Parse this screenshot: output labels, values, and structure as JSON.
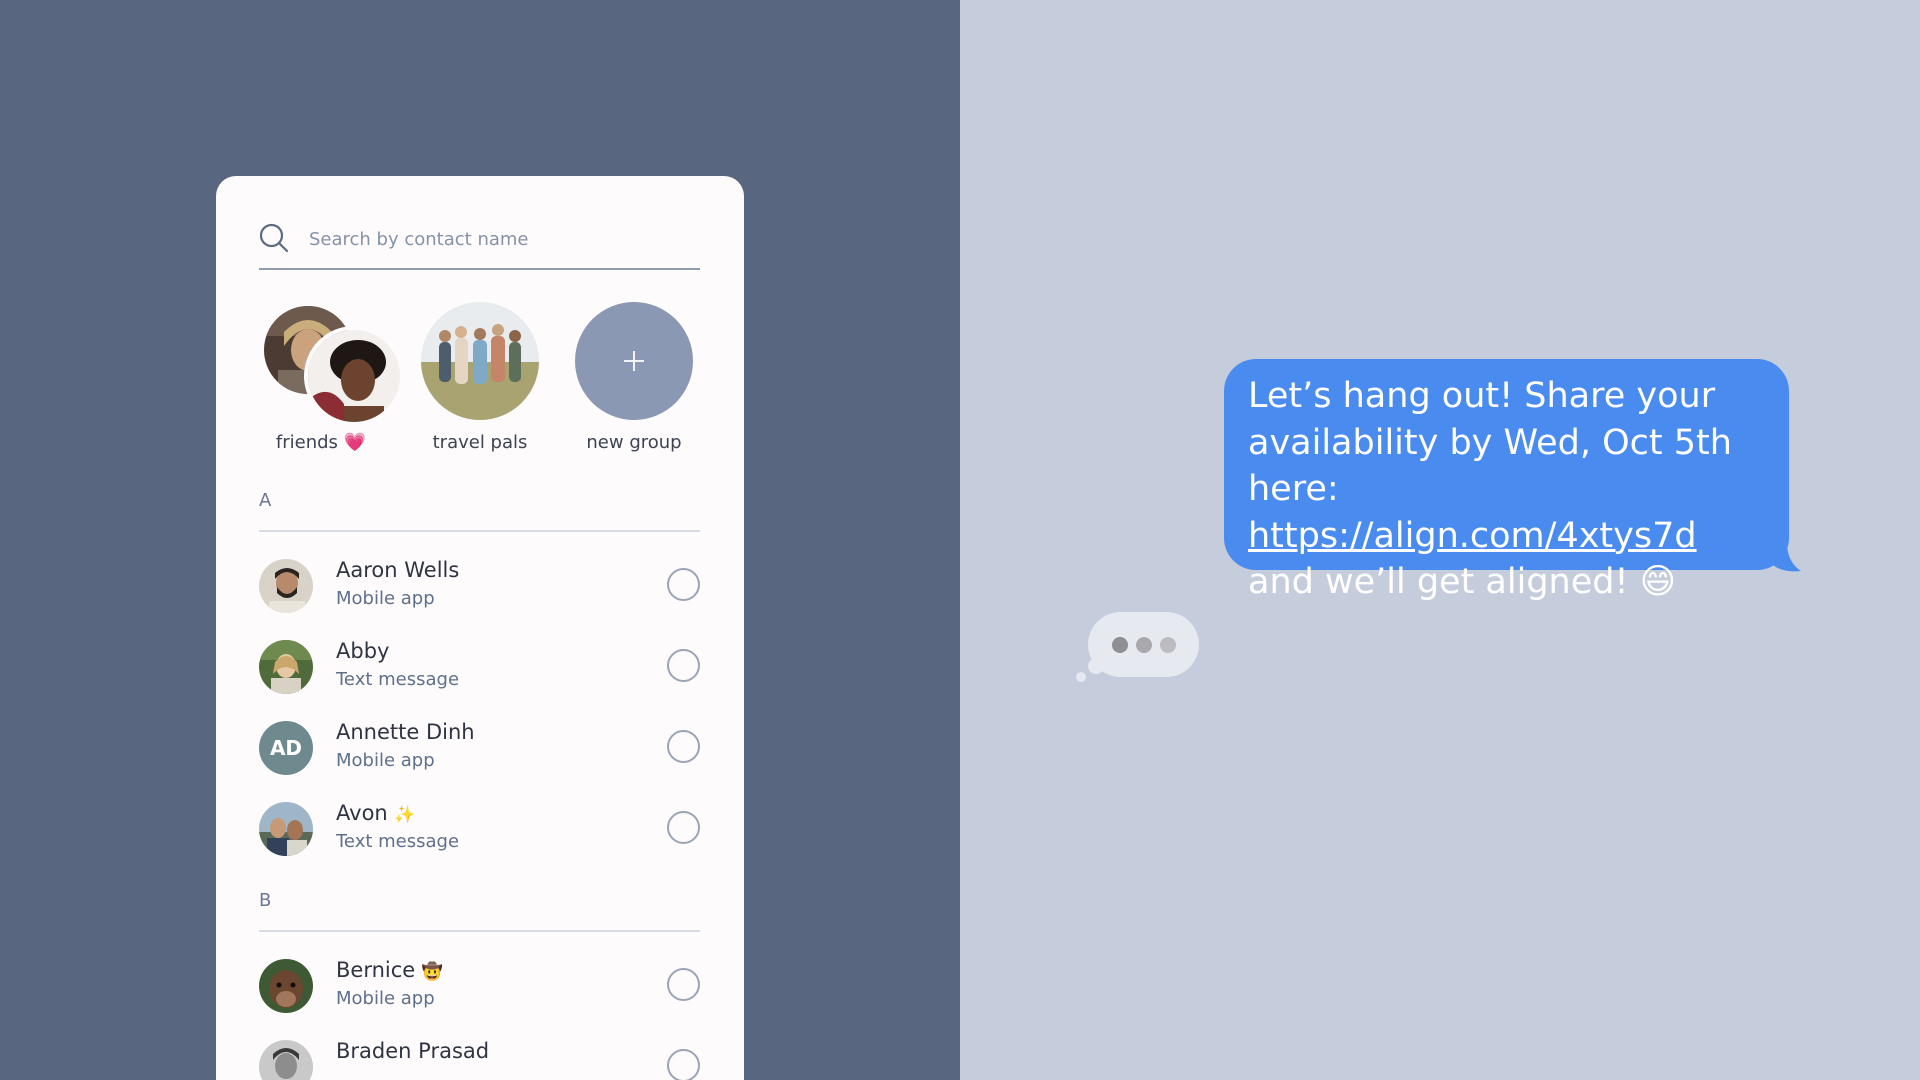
{
  "search": {
    "placeholder": "Search by contact name"
  },
  "groups": [
    {
      "label": "friends",
      "emoji": "💗"
    },
    {
      "label": "travel pals"
    },
    {
      "label": "new group",
      "icon": "plus-icon"
    }
  ],
  "sections": [
    {
      "letter": "A",
      "contacts": [
        {
          "name": "Aaron Wells",
          "sub": "Mobile app"
        },
        {
          "name": "Abby",
          "sub": "Text message"
        },
        {
          "name": "Annette Dinh",
          "sub": "Mobile app",
          "initials": "AD"
        },
        {
          "name": "Avon",
          "emoji": "✨",
          "sub": "Text message"
        }
      ]
    },
    {
      "letter": "B",
      "contacts": [
        {
          "name": "Bernice",
          "emoji": "🤠",
          "sub": "Mobile app"
        },
        {
          "name": "Braden Prasad",
          "sub": ""
        }
      ]
    }
  ],
  "message": {
    "line_1": "Let’s hang out! Share your",
    "line_2": "availability by Wed, Oct 5th",
    "line_3_prefix": "here: ",
    "link": "https://align.com/4xtys7d",
    "line_4": "and we’ll get aligned!",
    "emoji": "😄"
  },
  "colors": {
    "left_background": "#58667f",
    "right_background": "#c5ccdb",
    "bubble": "#4a8bf0",
    "typing_bubble": "#e6e9f0"
  }
}
